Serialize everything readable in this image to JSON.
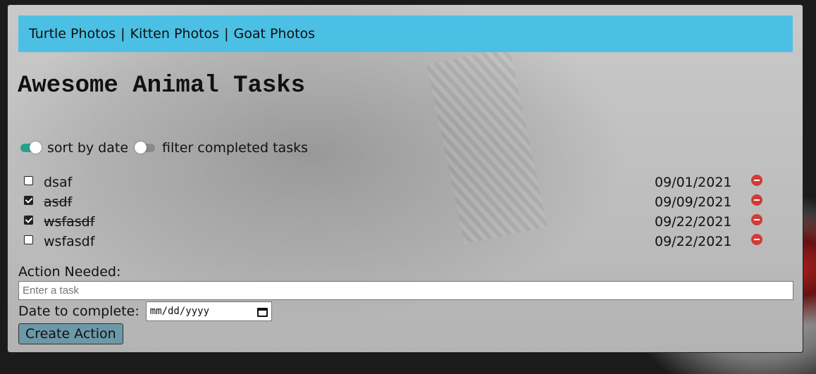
{
  "nav": {
    "links": [
      "Turtle Photos",
      "Kitten Photos",
      "Goat Photos"
    ],
    "separator": "|",
    "bar_color": "#4bc0e4"
  },
  "page_title": "Awesome Animal Tasks",
  "toggles": {
    "sort": {
      "label": "sort by date",
      "state": "on"
    },
    "filter": {
      "label": "filter completed tasks",
      "state": "off"
    }
  },
  "tasks": [
    {
      "name": "dsaf",
      "date": "09/01/2021",
      "completed": false
    },
    {
      "name": "asdf",
      "date": "09/09/2021",
      "completed": true
    },
    {
      "name": "wsfasdf",
      "date": "09/22/2021",
      "completed": true
    },
    {
      "name": "wsfasdf",
      "date": "09/22/2021",
      "completed": false
    }
  ],
  "form": {
    "action_label": "Action Needed:",
    "action_placeholder": "Enter a task",
    "action_value": "",
    "date_label": "Date to complete:",
    "date_placeholder": "mm/dd/yyyy",
    "create_label": "Create Action"
  },
  "icons": {
    "remove": "remove-icon",
    "calendar": "calendar-icon"
  },
  "colors": {
    "toggle_on": "#2aa08a",
    "remove": "#d23b36",
    "button": "#6d98a7"
  }
}
